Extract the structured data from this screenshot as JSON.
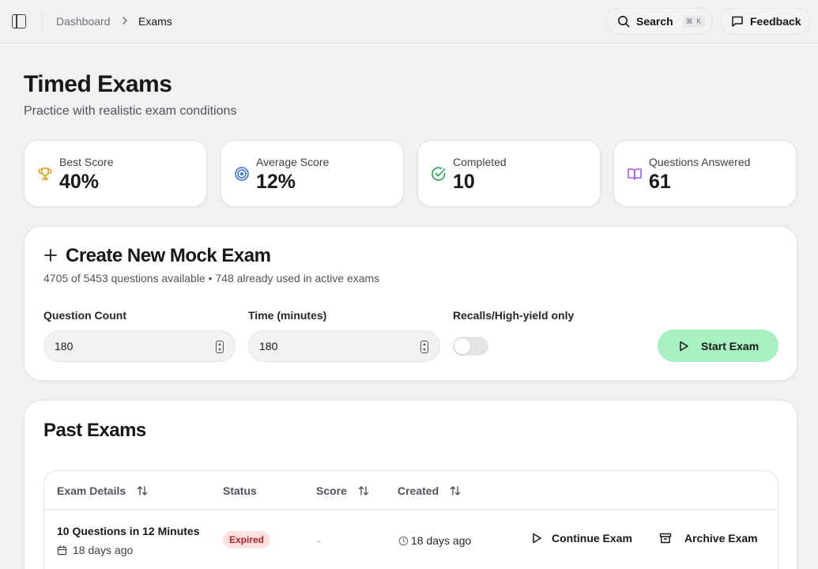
{
  "breadcrumb": {
    "parent": "Dashboard",
    "current": "Exams"
  },
  "topbar": {
    "search_label": "Search",
    "search_shortcut": "⌘ K",
    "feedback_label": "Feedback"
  },
  "header": {
    "title": "Timed Exams",
    "subtitle": "Practice with realistic exam conditions"
  },
  "stats": [
    {
      "label": "Best Score",
      "value": "40%",
      "icon": "trophy-icon",
      "color": "#d9a21b"
    },
    {
      "label": "Average Score",
      "value": "12%",
      "icon": "target-icon",
      "color": "#3b6fd8"
    },
    {
      "label": "Completed",
      "value": "10",
      "icon": "check-circle-icon",
      "color": "#22a34a"
    },
    {
      "label": "Questions Answered",
      "value": "61",
      "icon": "book-open-icon",
      "color": "#a855f7"
    }
  ],
  "create": {
    "title": "Create New Mock Exam",
    "subtitle": "4705 of 5453 questions available • 748 already used in active exams",
    "question_count_label": "Question Count",
    "question_count_value": "180",
    "time_label": "Time (minutes)",
    "time_value": "180",
    "recalls_label": "Recalls/High-yield only",
    "recalls_enabled": false,
    "start_label": "Start Exam",
    "accent": "#a7f0c0"
  },
  "past": {
    "title": "Past Exams",
    "columns": [
      "Exam Details",
      "Status",
      "Score",
      "Created"
    ],
    "rows": [
      {
        "title": "10 Questions in 12 Minutes",
        "date": "18 days ago",
        "status": "Expired",
        "score": "-",
        "created": "18 days ago",
        "continue_label": "Continue Exam",
        "archive_label": "Archive Exam"
      }
    ]
  }
}
